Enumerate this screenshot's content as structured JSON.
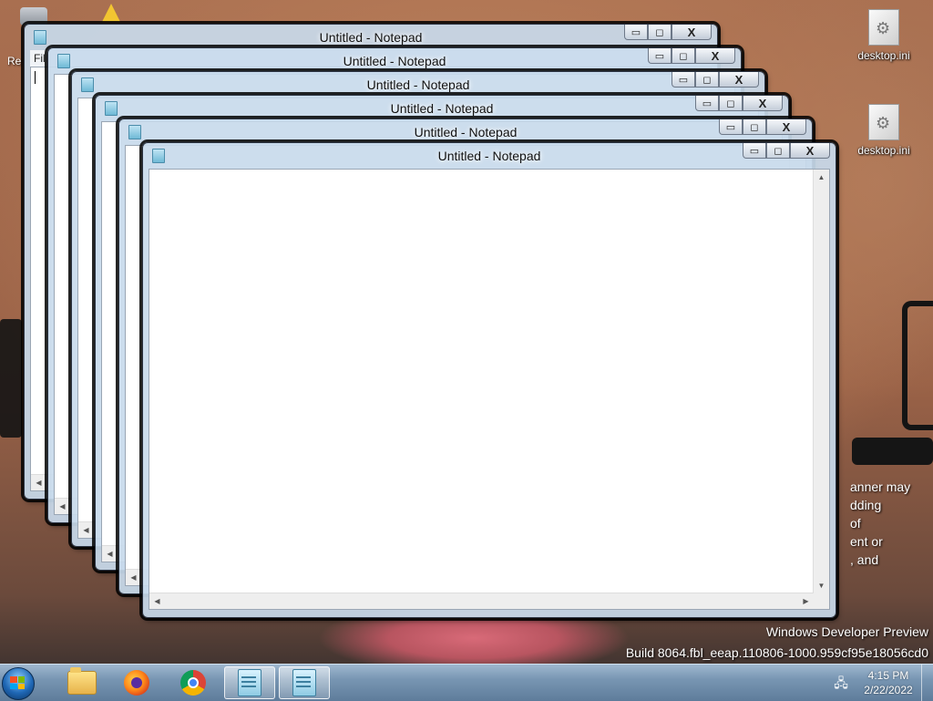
{
  "desktop": {
    "icons": [
      {
        "label": "desktop.ini",
        "icon": "settings-file-icon"
      },
      {
        "label": "desktop.ini",
        "icon": "settings-file-icon"
      }
    ],
    "partial_icon_label": "Re",
    "banner_lines": [
      "anner may",
      "dding",
      "of",
      "ent or",
      ", and"
    ],
    "watermark": {
      "line1": "Windows Developer Preview",
      "line2": "Build 8064.fbl_eeap.110806-1000.959cf95e18056cd0"
    }
  },
  "windows": [
    {
      "title": "Untitled - Notepad",
      "menu_partial": "Fil"
    },
    {
      "title": "Untitled - Notepad"
    },
    {
      "title": "Untitled - Notepad"
    },
    {
      "title": "Untitled - Notepad"
    },
    {
      "title": "Untitled - Notepad"
    },
    {
      "title": "Untitled - Notepad"
    }
  ],
  "window_controls": {
    "minimize": "▭",
    "maximize": "◻",
    "close": "X"
  },
  "taskbar": {
    "buttons": [
      {
        "name": "file-explorer",
        "icon": "folder-icon"
      },
      {
        "name": "firefox",
        "icon": "firefox-icon"
      },
      {
        "name": "chrome",
        "icon": "chrome-icon"
      },
      {
        "name": "notepad-pinned",
        "icon": "notepad-icon"
      },
      {
        "name": "notepad-active",
        "icon": "notepad-icon"
      }
    ],
    "clock": {
      "time": "4:15 PM",
      "date": "2/22/2022"
    }
  },
  "colors": {
    "taskbar": "#7896b3",
    "window_frame": "#c8daeb"
  }
}
